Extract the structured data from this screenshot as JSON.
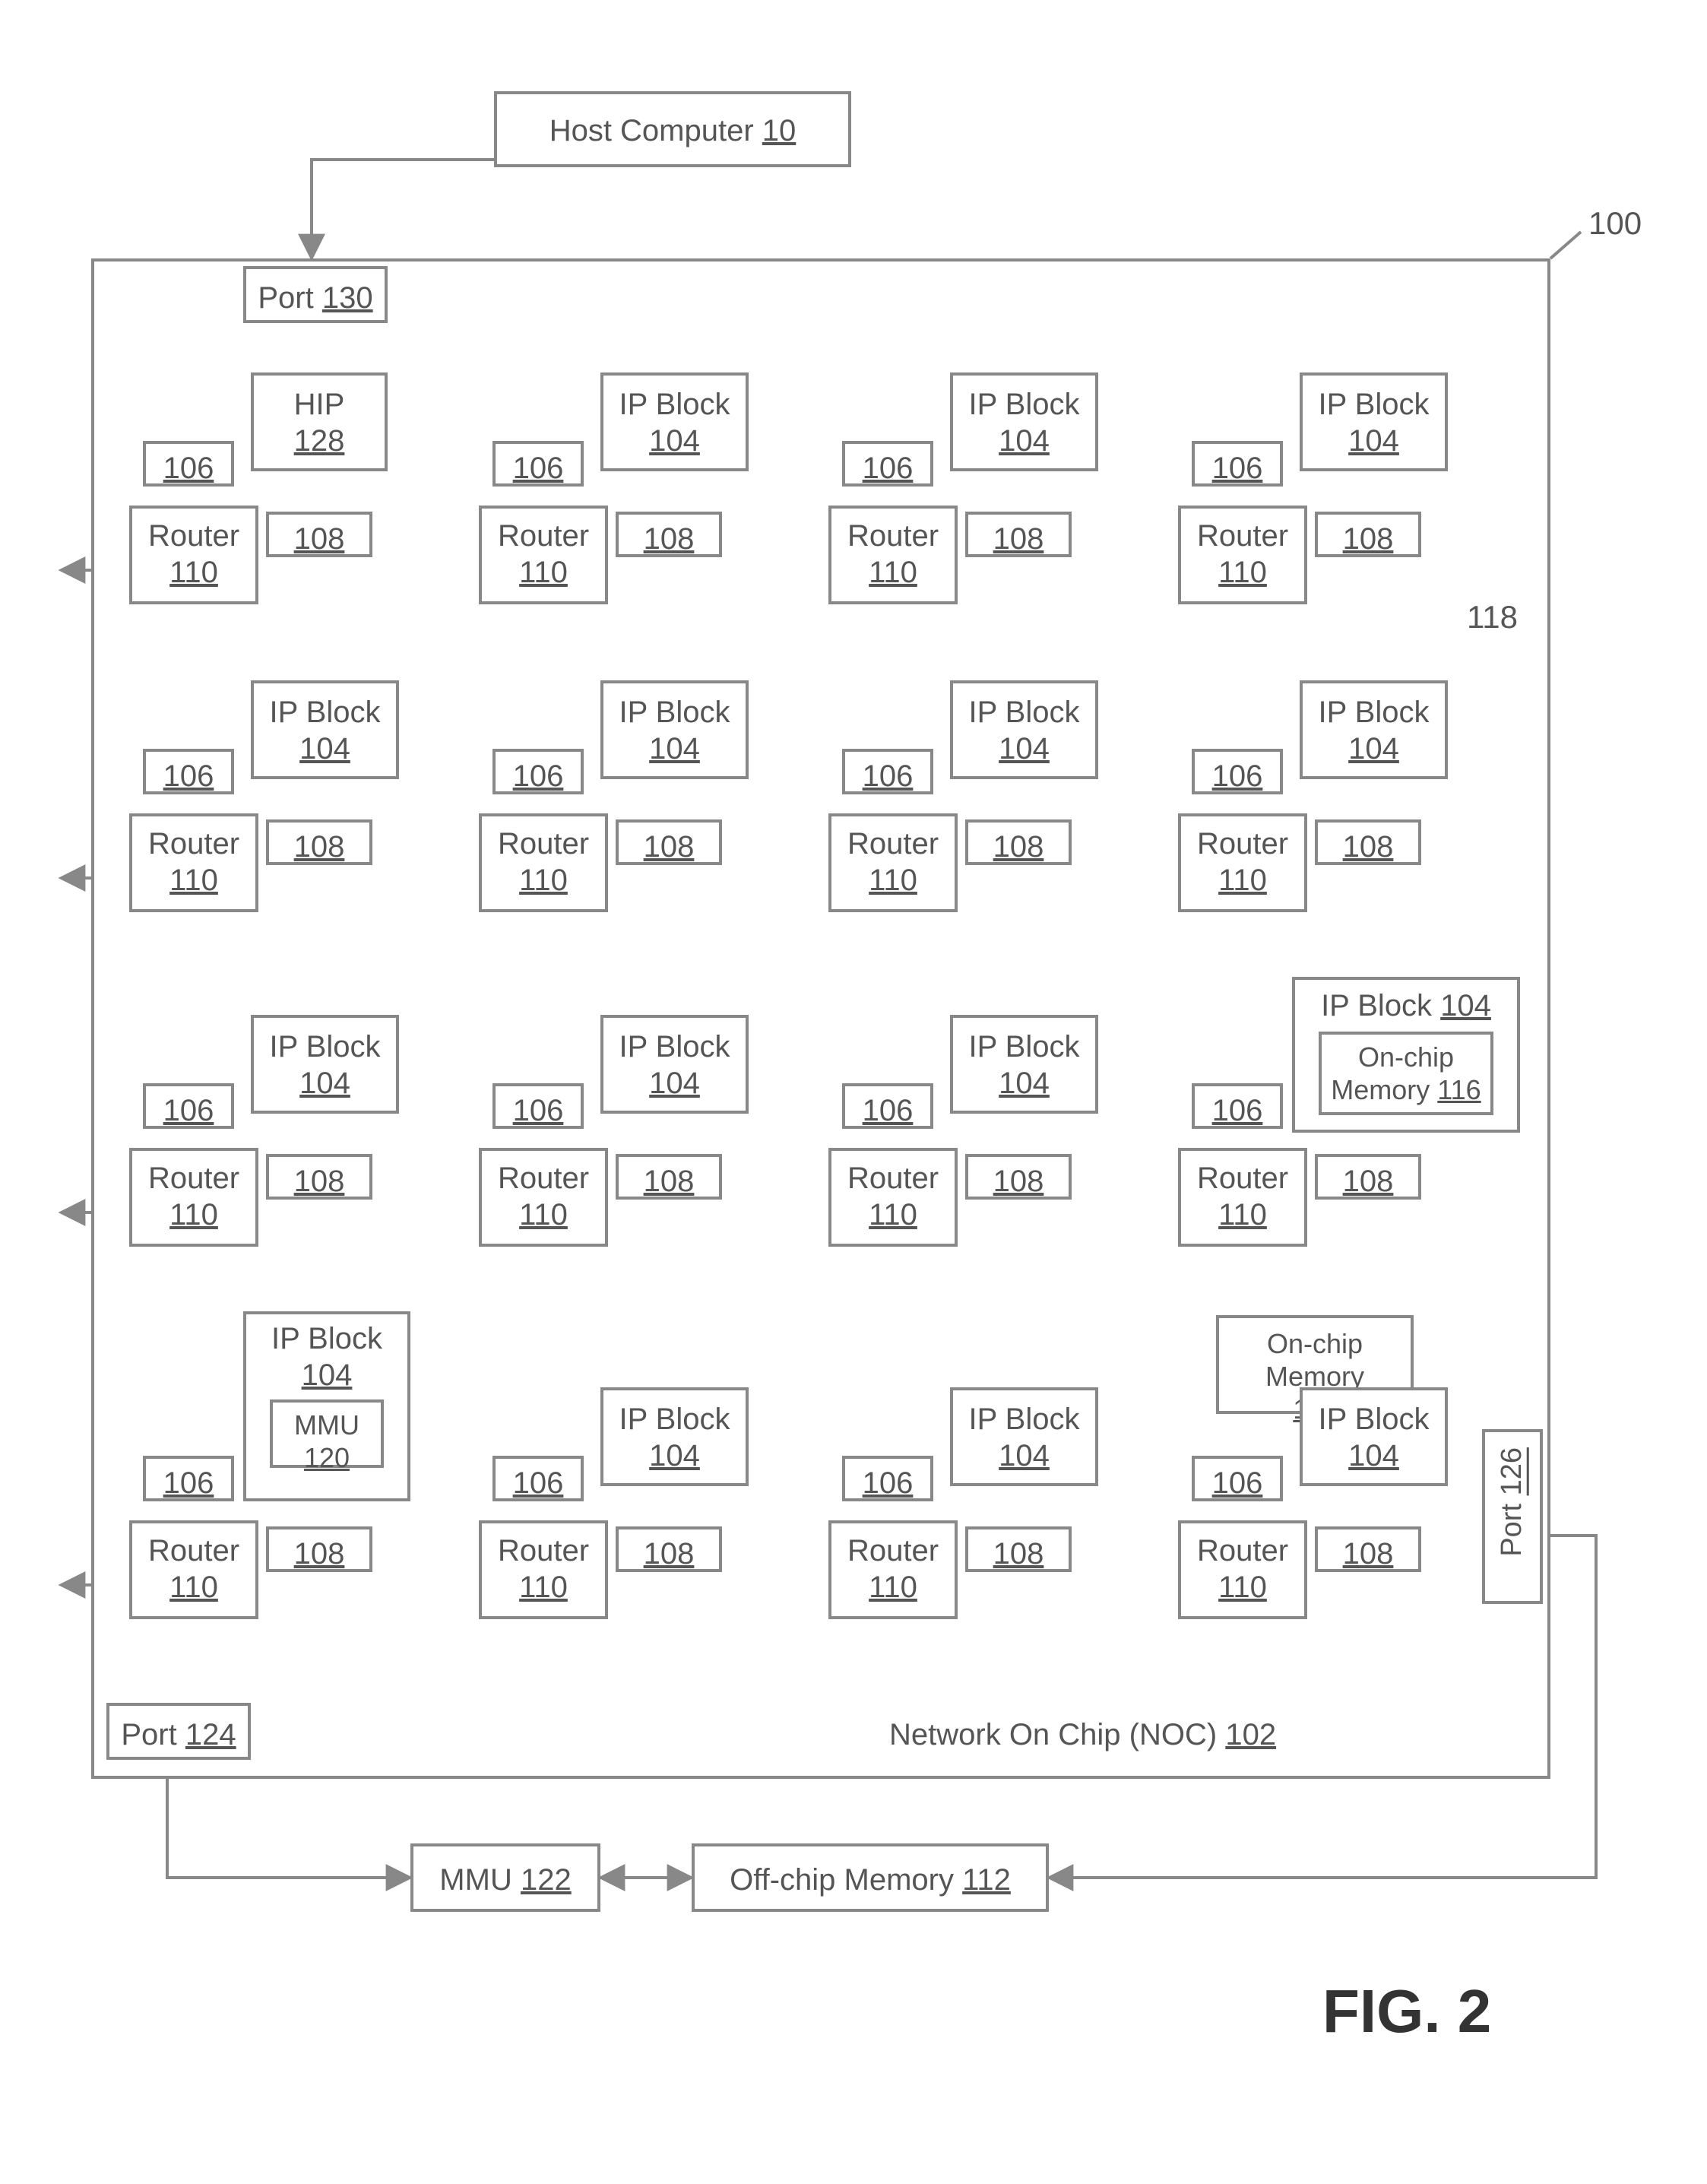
{
  "figure_label": "FIG. 2",
  "ref_100": "100",
  "ref_118": "118",
  "host": {
    "label": "Host Computer",
    "num": "10"
  },
  "port_130": {
    "label": "Port",
    "num": "130"
  },
  "port_124": {
    "label": "Port",
    "num": "124"
  },
  "port_126": {
    "label": "Port",
    "num": "126"
  },
  "mmu_122": {
    "label": "MMU",
    "num": "122"
  },
  "offchip": {
    "label": "Off-chip  Memory",
    "num": "112"
  },
  "noc": {
    "label": "Network On Chip (NOC)",
    "num": "102"
  },
  "onchip_114": {
    "label": "On-chip Memory",
    "num": "114"
  },
  "onchip_116": {
    "label": "On-chip Memory",
    "num": "116"
  },
  "ip_label": "IP Block",
  "ip_num": "104",
  "hip_label": "HIP",
  "hip_num": "128",
  "mmu_120": {
    "label": "MMU",
    "num": "120"
  },
  "router_label": "Router",
  "router_num": "110",
  "n106": "106",
  "n108": "108"
}
